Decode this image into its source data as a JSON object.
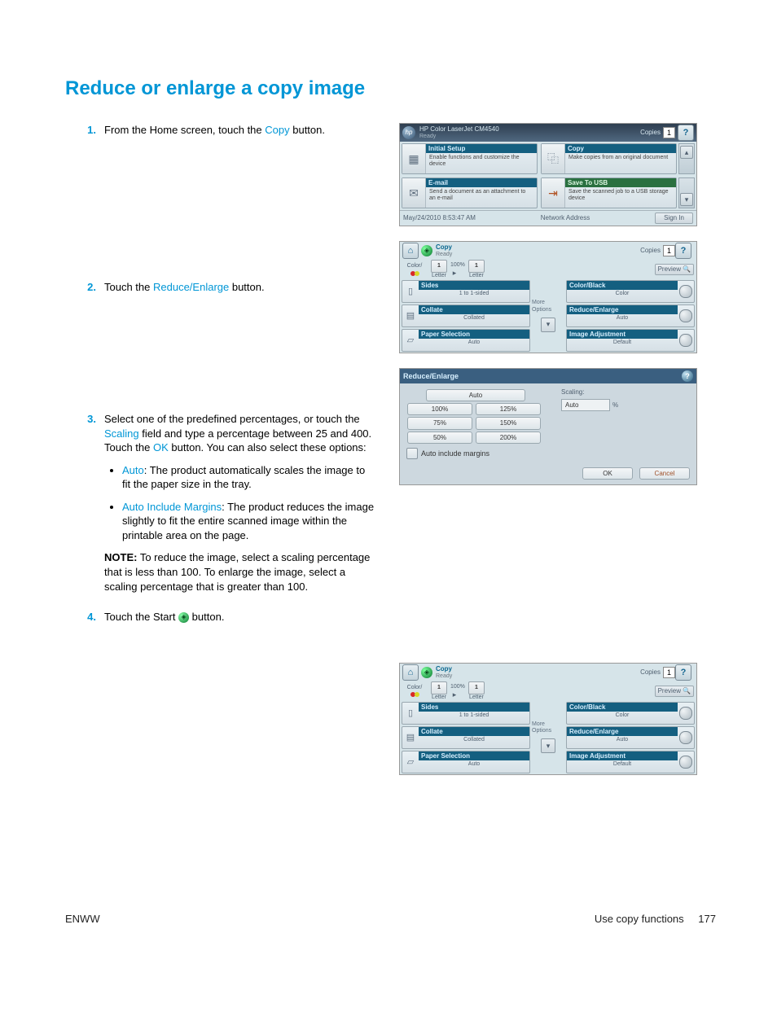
{
  "title": "Reduce or enlarge a copy image",
  "steps": {
    "s1": {
      "text_a": "From the Home screen, touch the ",
      "link": "Copy",
      "text_b": " button."
    },
    "s2": {
      "text_a": "Touch the ",
      "link": "Reduce/Enlarge",
      "text_b": " button."
    },
    "s3": {
      "text_a": "Select one of the predefined percentages, or touch the ",
      "link1": "Scaling",
      "text_b": " field and type a percentage between 25 and 400. Touch the ",
      "link2": "OK",
      "text_c": " button. You can also select these options:",
      "bullet1_link": "Auto",
      "bullet1_text": ": The product automatically scales the image to fit the paper size in the tray.",
      "bullet2_link": "Auto Include Margins",
      "bullet2_text": ": The product reduces the image slightly to fit the entire scanned image within the printable area on the page.",
      "note_label": "NOTE:",
      "note_text": "   To reduce the image, select a scaling percentage that is less than 100. To enlarge the image, select a scaling percentage that is greater than 100."
    },
    "s4": {
      "text_a": "Touch the Start ",
      "text_b": " button."
    }
  },
  "shot_home": {
    "device": "HP Color LaserJet CM4540",
    "status": "Ready",
    "copies_label": "Copies",
    "copies_value": "1",
    "tiles": {
      "initial_setup": {
        "title": "Initial Setup",
        "sub": "Enable functions and customize the device"
      },
      "copy": {
        "title": "Copy",
        "sub": "Make copies from an original document"
      },
      "email": {
        "title": "E-mail",
        "sub": "Send a document as an attachment to an e-mail"
      },
      "save_usb": {
        "title": "Save To USB",
        "sub": "Save the scanned job to a USB storage device"
      }
    },
    "timestamp": "May/24/2010 8:53:47 AM",
    "network": "Network Address",
    "signin": "Sign In"
  },
  "shot_copy": {
    "title_l1": "Copy",
    "title_l2": "Ready",
    "copies_label": "Copies",
    "copies_value": "1",
    "color": "Color/",
    "pg_left_num": "1",
    "pg_left_size": "Letter",
    "pct": "100%",
    "pg_right_num": "1",
    "pg_right_size": "Letter",
    "preview": "Preview",
    "more_options": "More Options",
    "opts": {
      "sides": {
        "title": "Sides",
        "val": "1 to 1-sided"
      },
      "collate": {
        "title": "Collate",
        "val": "Collated"
      },
      "paper": {
        "title": "Paper Selection",
        "val": "Auto"
      },
      "colorblack": {
        "title": "Color/Black",
        "val": "Color"
      },
      "reduce": {
        "title": "Reduce/Enlarge",
        "val": "Auto"
      },
      "imgadj": {
        "title": "Image Adjustment",
        "val": "Default"
      }
    }
  },
  "shot_re": {
    "title": "Reduce/Enlarge",
    "auto": "Auto",
    "p100": "100%",
    "p125": "125%",
    "p75": "75%",
    "p150": "150%",
    "p50": "50%",
    "p200": "200%",
    "scaling": "Scaling:",
    "scaling_val": "Auto",
    "pct": "%",
    "aim": "Auto include margins",
    "ok": "OK",
    "cancel": "Cancel"
  },
  "footer": {
    "left": "ENWW",
    "right_label": "Use copy functions",
    "page_num": "177"
  }
}
